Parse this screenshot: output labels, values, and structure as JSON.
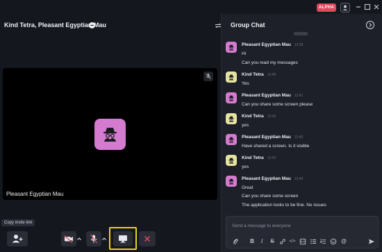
{
  "topbar": {
    "badge": "ALPHA"
  },
  "call": {
    "title": "Kind Tetra, Pleasant Egyptian Mau",
    "tile_name": "Pleasant Egyptian Mau"
  },
  "controls": {
    "tooltip": "Copy invite link"
  },
  "chat": {
    "title": "Group Chat",
    "messages": [
      {
        "name": "Pleasant Egyptian Mau",
        "time": "12:39",
        "lines": [
          "Hi",
          "Can you read my messages"
        ],
        "color": "#d47bd0"
      },
      {
        "name": "Kind Tetra",
        "time": "12:40",
        "lines": [
          "Yes"
        ],
        "color": "#e4e3a0"
      },
      {
        "name": "Pleasant Egyptian Mau",
        "time": "12:41",
        "lines": [
          "Can you share some screen please"
        ],
        "color": "#d47bd0"
      },
      {
        "name": "Kind Tetra",
        "time": "12:42",
        "lines": [
          "yes"
        ],
        "color": "#e4e3a0"
      },
      {
        "name": "Pleasant Egyptian Mau",
        "time": "12:42",
        "lines": [
          "Have shared a screen. Is it visible"
        ],
        "color": "#d47bd0"
      },
      {
        "name": "Kind Tetra",
        "time": "12:42",
        "lines": [
          "yes"
        ],
        "color": "#e4e3a0"
      },
      {
        "name": "Pleasant Egyptian Mau",
        "time": "12:42",
        "lines": [
          "Great",
          "Can you share some screen",
          "The application looks to be fine. No issues"
        ],
        "color": "#d47bd0"
      }
    ],
    "composer_placeholder": "Send a message to everyone"
  },
  "colors": {
    "accent_pink": "#d47bd0",
    "accent_yellow": "#e4e3a0",
    "alpha_red": "#e0485c",
    "highlight_yellow": "#e9d617",
    "end_call_red": "#e0485c"
  },
  "icons": {
    "invite": "add-user-icon",
    "camera_off": "camera-off-icon",
    "mic_off": "mic-off-icon",
    "screen": "monitor-icon",
    "end": "close-icon"
  }
}
